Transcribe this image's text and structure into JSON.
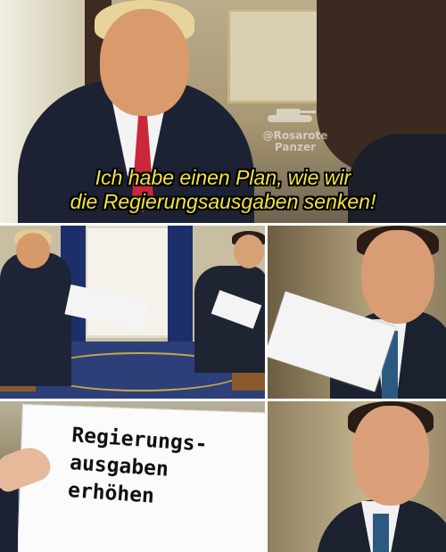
{
  "meme": {
    "watermark": {
      "line1": "@Rosarote",
      "line2": "Panzer"
    },
    "top_caption": {
      "line1": "Ich habe einen Plan, wie wir",
      "line2": "die Regierungsausgaben senken!"
    },
    "paper_note": {
      "line1": "Regierungs-",
      "line2": "ausgaben",
      "line3": "erhöhen"
    },
    "colors": {
      "caption_fill": "#f3e43b",
      "caption_outline": "#000000",
      "gutter": "#ffffff"
    }
  }
}
